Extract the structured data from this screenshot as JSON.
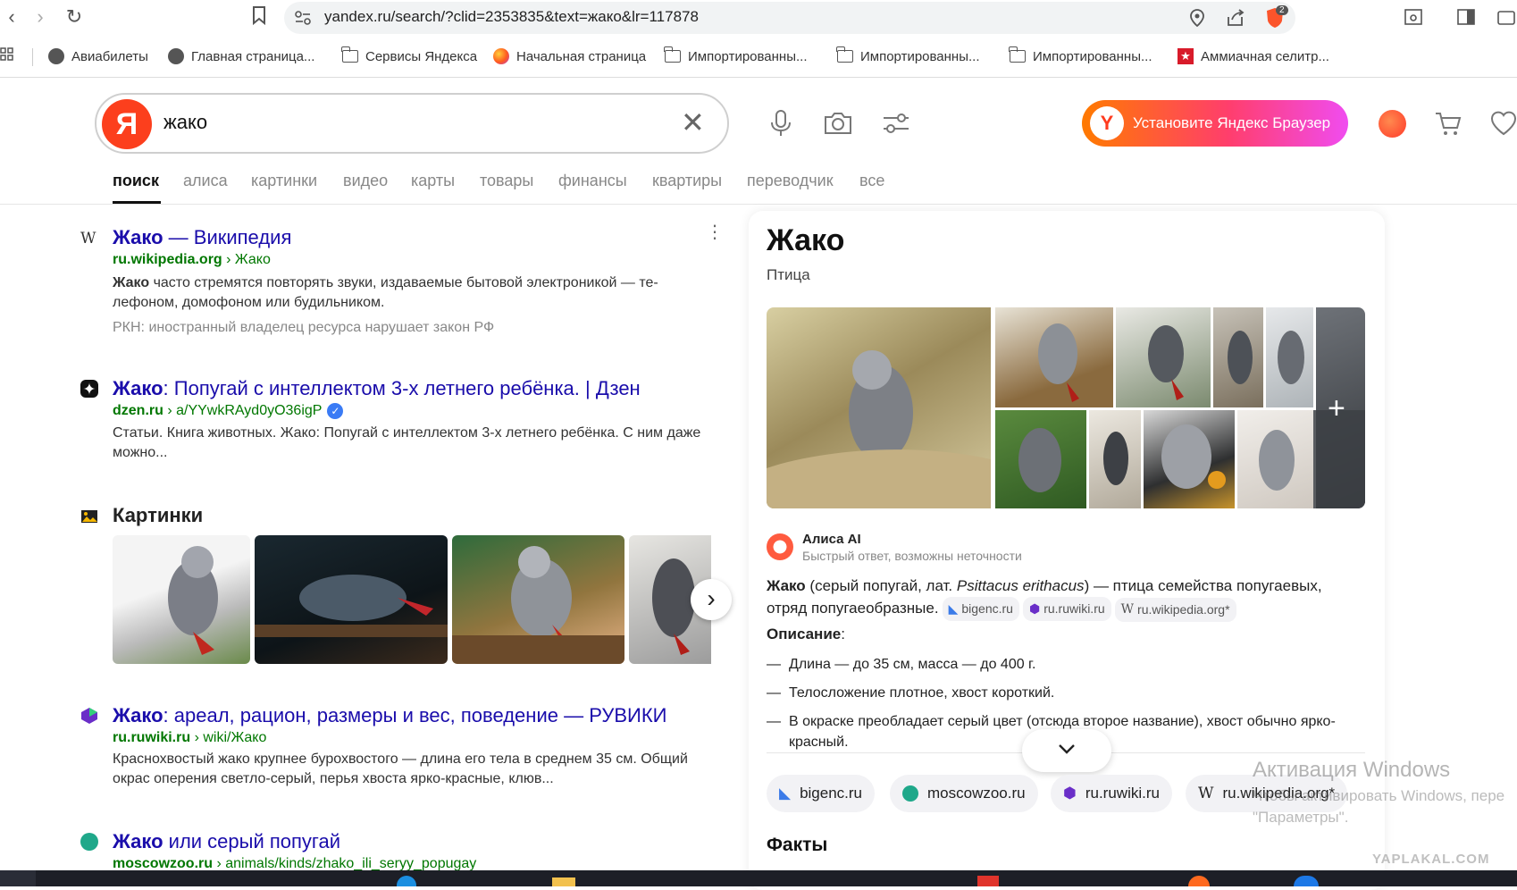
{
  "browser": {
    "url": "yandex.ru/search/?clid=2353835&text=жако&lr=117878",
    "shield_badge": "2",
    "bookmarks": [
      {
        "label": "Авиабилеты",
        "icon": "globe-icon"
      },
      {
        "label": "Главная страница...",
        "icon": "globe-icon"
      },
      {
        "label": "Сервисы Яндекса",
        "icon": "folder-icon"
      },
      {
        "label": "Начальная страница",
        "icon": "firefox-icon"
      },
      {
        "label": "Импортированны...",
        "icon": "folder-icon"
      },
      {
        "label": "Импортированны...",
        "icon": "folder-icon"
      },
      {
        "label": "Импортированны...",
        "icon": "folder-icon"
      },
      {
        "label": "Аммиачная селитр...",
        "icon": "star-icon"
      }
    ]
  },
  "search": {
    "logo": "Я",
    "query": "жако",
    "install_button": "Установите Яндекс Браузер",
    "install_logo": "Y",
    "tabs": [
      "поиск",
      "алиса",
      "картинки",
      "видео",
      "карты",
      "товары",
      "финансы",
      "квартиры",
      "переводчик",
      "все"
    ]
  },
  "results": [
    {
      "title_bold": "Жако",
      "title_rest": " — Википедия",
      "url_domain": "ru.wikipedia.org",
      "url_path": " › Жако",
      "snippet_bold": "Жако",
      "snippet": " часто стремятся повторять звуки, издаваемые бытовой электроникой — те-лефоном, домофоном или будильником.",
      "note": "РКН: иностранный владелец ресурса нарушает закон РФ",
      "favicon": "W"
    },
    {
      "title_bold": "Жако",
      "title_rest": ": Попугай с интеллектом 3-х летнего ребёнка. | Дзен",
      "url_domain": "dzen.ru",
      "url_path": " › a/YYwkRAyd0yO36igP",
      "snippet": "Статьи. Книга животных. Жако: Попугай с интеллектом 3-х летнего ребёнка. С ним даже можно..."
    },
    {
      "title_bold": "Жако",
      "title_rest": ": ареал, рацион, размеры и вес, поведение — РУВИКИ",
      "url_domain": "ru.ruwiki.ru",
      "url_path": " › wiki/Жако",
      "snippet": "Краснохвостый жако крупнее бурохвостого — длина его тела в среднем 35 см. Общий окрас оперения светло-серый, перья хвоста ярко-красные, клюв..."
    },
    {
      "title_bold": "Жако",
      "title_rest": " или серый попугай",
      "url_domain": "moscowzoo.ru",
      "url_path": " › animals/kinds/zhako_ili_seryy_popugay"
    }
  ],
  "images_block": {
    "title": "Картинки"
  },
  "knowledge_panel": {
    "title": "Жако",
    "subtitle": "Птица",
    "alice_name": "Алиса AI",
    "alice_note": "Быстрый ответ, возможны неточности",
    "answer_bold": "Жако",
    "answer_part1": " (серый попугай, лат. ",
    "answer_italic": "Psittacus erithacus",
    "answer_part2": ") — птица семейства попугаевых, отряд попугаеобразные.",
    "answer_sources": [
      "bigenc.ru",
      "ru.ruwiki.ru",
      "ru.wikipedia.org*"
    ],
    "desc_label": "Описание",
    "desc_colon": ":",
    "bullets": [
      "Длина — до 35 см, масса — до 400 г.",
      "Телосложение плотное, хвост короткий.",
      "В окраске преобладает серый цвет (отсюда второе название), хвост обычно ярко-красный."
    ],
    "source_chips": [
      "bigenc.ru",
      "moscowzoo.ru",
      "ru.ruwiki.ru",
      "ru.wikipedia.org*"
    ],
    "facts_title": "Факты"
  },
  "watermark": {
    "line1": "Активация Windows",
    "line2": "Чтобы активировать Windows, пере",
    "line3": "\"Параметры\".",
    "site": "YAPLAKAL.COM"
  }
}
